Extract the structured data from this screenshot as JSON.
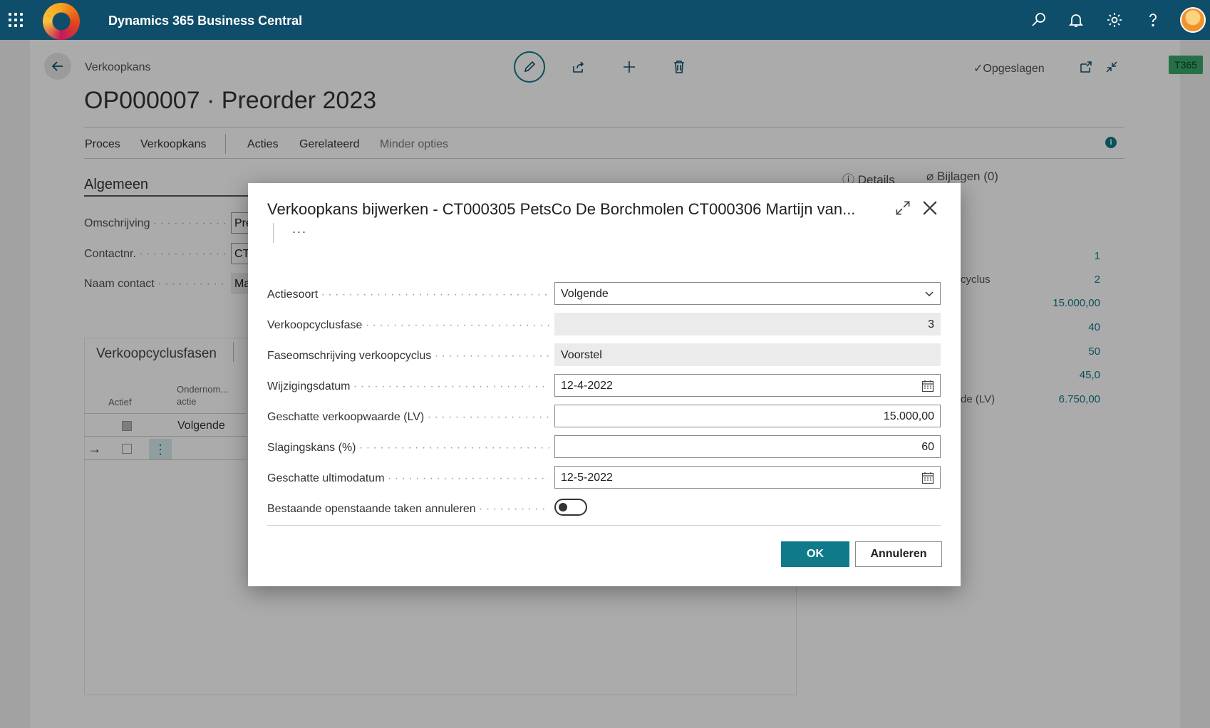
{
  "app": {
    "title": "Dynamics 365 Business Central"
  },
  "topbar_icons": [
    "search-icon",
    "bell-icon",
    "gear-icon",
    "help-icon"
  ],
  "page": {
    "breadcrumb": "Verkoopkans",
    "title": "OP000007 · Preorder 2023",
    "saved_status": "Opgeslagen",
    "env_badge": "T365",
    "menu": [
      "Proces",
      "Verkoopkans",
      "Acties",
      "Gerelateerd",
      "Minder opties"
    ],
    "section_title": "Algemeen",
    "fields": [
      {
        "label": "Omschrijving",
        "value": "Pre"
      },
      {
        "label": "Contactnr.",
        "value": "CT"
      },
      {
        "label": "Naam contact",
        "value": "Ma"
      }
    ],
    "part_title": "Verkoopcyclusfasen",
    "columns": [
      "Actief",
      "Ondernom... actie"
    ],
    "rows": [
      {
        "active": true,
        "action": "Volgende"
      },
      {
        "active": false,
        "action": ""
      }
    ],
    "factbox": {
      "tabs": [
        "Details",
        "Bijlagen (0)"
      ],
      "values": [
        "1",
        "2",
        "15.000,00",
        "40",
        "50",
        "45,0",
        "6.750,00"
      ],
      "label_fragments": [
        "cyclus",
        "de (LV)"
      ]
    }
  },
  "dialog": {
    "title": "Verkoopkans bijwerken - CT000305 PetsCo De Borchmolen CT000306 Martijn van...",
    "more": "...",
    "fields": {
      "actiesoort": {
        "label": "Actiesoort",
        "value": "Volgende"
      },
      "fase": {
        "label": "Verkoopcyclusfase",
        "value": "3"
      },
      "faseomschrijving": {
        "label": "Faseomschrijving verkoopcyclus",
        "value": "Voorstel"
      },
      "wijzigingsdatum": {
        "label": "Wijzigingsdatum",
        "value": "12-4-2022"
      },
      "waarde": {
        "label": "Geschatte verkoopwaarde (LV)",
        "value": "15.000,00"
      },
      "slagingskans": {
        "label": "Slagingskans (%)",
        "value": "60"
      },
      "ultimodatum": {
        "label": "Geschatte ultimodatum",
        "value": "12-5-2022"
      },
      "annuleren_taken": {
        "label": "Bestaande openstaande taken annuleren",
        "on": false
      }
    },
    "ok_label": "OK",
    "cancel_label": "Annuleren"
  },
  "colors": {
    "topbar": "#0f4e6a",
    "accent": "#0f7a8a"
  }
}
